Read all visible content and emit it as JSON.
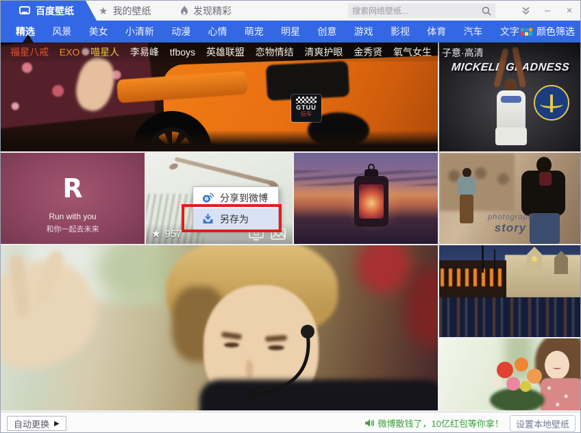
{
  "titlebar": {
    "app_title": "百度壁纸",
    "tab_my": "我的壁纸",
    "tab_discover": "发现精彩",
    "search_placeholder": "搜索网络壁纸...",
    "minimize": "–",
    "close": "×"
  },
  "nav": {
    "items": [
      "精选",
      "风景",
      "美女",
      "小清新",
      "动漫",
      "心情",
      "萌宠",
      "明星",
      "创意",
      "游戏",
      "影视",
      "体育",
      "汽车",
      "文字"
    ],
    "active_item": "精选",
    "color_filter": "颜色筛选"
  },
  "tags": [
    "福星八戒",
    "EXO",
    "喵星人",
    "李易峰",
    "tfboys",
    "英雄联盟",
    "恋物情结",
    "清爽护眼",
    "金秀贤",
    "氧气女生"
  ],
  "right_tag": "子意·高清",
  "tiles": {
    "basketball": {
      "title": "MICKELL GLADNESS"
    },
    "car": {
      "badge_brand": "GTUU",
      "badge_sub": "玩车"
    },
    "run": {
      "logo": "R",
      "title": "Run with you",
      "subtitle": "和你一起去未来"
    },
    "fashion": {
      "caption_line1": "photograph",
      "caption_line2": "story"
    },
    "hover": {
      "star_icon": "★",
      "star_count": "957"
    }
  },
  "context_menu": {
    "share_weibo": "分享到微博",
    "save_as": "另存为"
  },
  "bottom": {
    "auto_change": "自动更换",
    "play": "▶",
    "notice": "微博散钱了，10亿红包等你拿！",
    "set_local": "设置本地壁纸"
  },
  "colors": {
    "accent_blue": "#3467e4",
    "menu_highlight": "#d8e2f4",
    "annotation_red": "#e51a1a",
    "notice_green": "#3ca03c",
    "tag_red": "#e0512d",
    "tag_orange": "#f0902f",
    "tag_yellow": "#eac83f"
  }
}
